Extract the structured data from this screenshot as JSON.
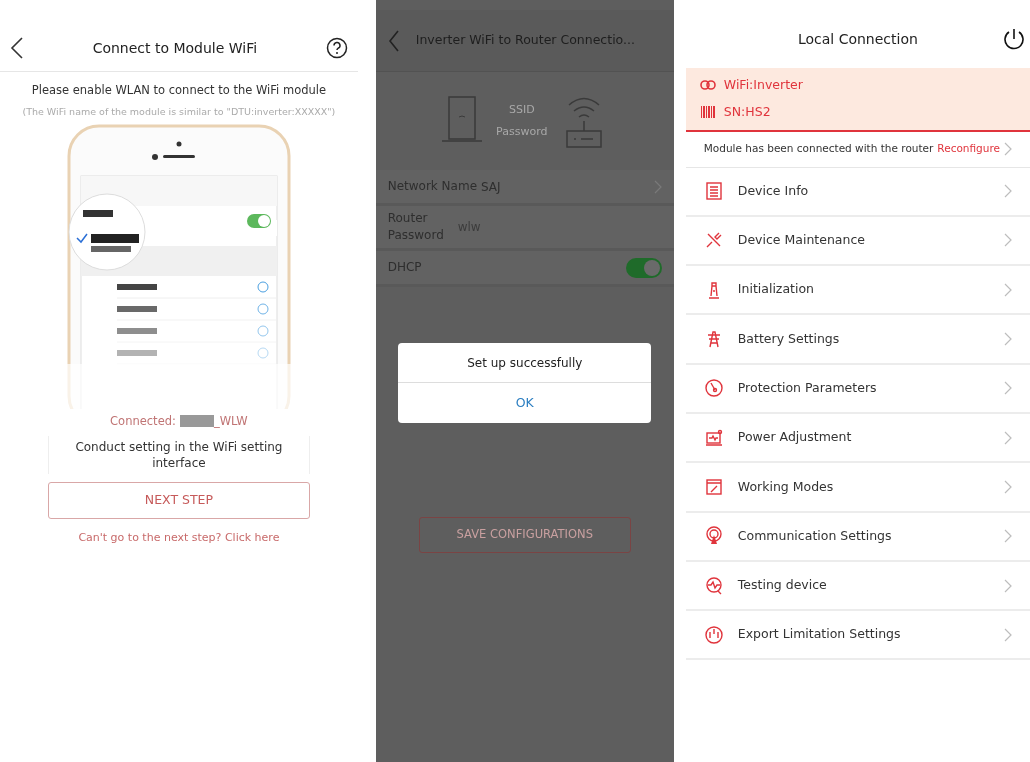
{
  "wifi_screen": {
    "title": "Connect to Module WiFi",
    "instruction": "Please enable WLAN to connect to the WiFi module",
    "hint": "(The WiFi name of the module is similar to \"DTU:inverter:XXXXX\")",
    "connected_label": "Connected:",
    "connected_value": "_WLW",
    "setting_box": "Conduct setting in the WiFi setting interface",
    "next_button": "NEXT STEP",
    "help_link": "Can't go to the next step? Click here"
  },
  "router_screen": {
    "title": "Inverter WiFi to Router Connectio...",
    "diagram_labels": [
      "SSID",
      "Password"
    ],
    "fields": [
      {
        "kind": "select",
        "label": "Network Name",
        "value": "SAJ"
      },
      {
        "kind": "text",
        "label": "Router Password",
        "value": "wlw"
      },
      {
        "kind": "toggle",
        "label": "DHCP",
        "on": true
      }
    ],
    "save_button": "SAVE CONFIGURATIONS",
    "dialog": {
      "message": "Set up successfully",
      "button": "OK"
    }
  },
  "local_screen": {
    "title": "Local Connection",
    "wifi": "WiFi:Inverter",
    "sn": "SN:HS2",
    "status": "Module has been connected with the router",
    "reconfigure": "Reconfigure",
    "menu": [
      {
        "label": "Device Info"
      },
      {
        "label": "Device Maintenance"
      },
      {
        "label": "Initialization"
      },
      {
        "label": "Battery Settings"
      },
      {
        "label": "Protection Parameters"
      },
      {
        "label": "Power Adjustment"
      },
      {
        "label": "Working Modes"
      },
      {
        "label": "Communication Settings"
      },
      {
        "label": "Testing device"
      },
      {
        "label": "Export Limitation Settings"
      }
    ]
  }
}
